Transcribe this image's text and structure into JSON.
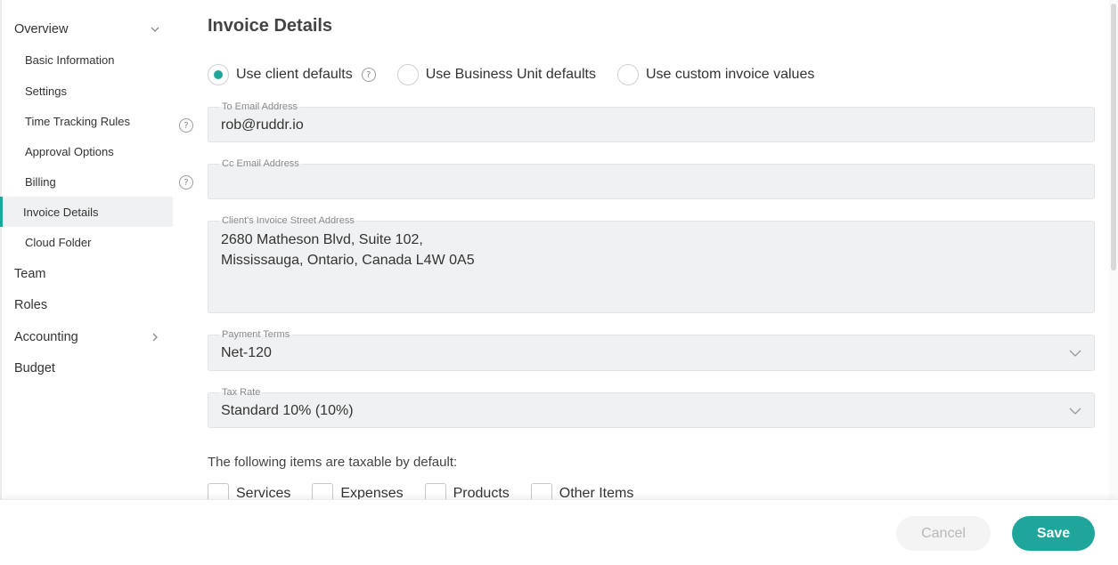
{
  "sidebar": {
    "overview": "Overview",
    "sub_items": [
      {
        "label": "Basic Information"
      },
      {
        "label": "Settings"
      },
      {
        "label": "Time Tracking Rules"
      },
      {
        "label": "Approval Options"
      },
      {
        "label": "Billing"
      },
      {
        "label": "Invoice Details"
      },
      {
        "label": "Cloud Folder"
      }
    ],
    "team": "Team",
    "roles": "Roles",
    "accounting": "Accounting",
    "budget": "Budget",
    "help_glyph": "?"
  },
  "main": {
    "title": "Invoice Details",
    "radios": [
      {
        "label": "Use client defaults",
        "selected": true
      },
      {
        "label": "Use Business Unit defaults",
        "selected": false
      },
      {
        "label": "Use custom invoice values",
        "selected": false
      }
    ],
    "fields": {
      "to_email": {
        "label": "To Email Address",
        "value": "rob@ruddr.io"
      },
      "cc_email": {
        "label": "Cc Email Address",
        "value": ""
      },
      "street": {
        "label": "Client's Invoice Street Address",
        "value": "2680 Matheson Blvd, Suite 102,\nMississauga, Ontario, Canada L4W 0A5"
      },
      "payment_terms": {
        "label": "Payment Terms",
        "value": "Net-120"
      },
      "tax_rate": {
        "label": "Tax Rate",
        "value": "Standard 10% (10%)"
      }
    },
    "taxable_label": "The following items are taxable by default:",
    "taxable_items": [
      "Services",
      "Expenses",
      "Products",
      "Other Items"
    ]
  },
  "footer": {
    "cancel": "Cancel",
    "save": "Save"
  },
  "colors": {
    "accent": "#1fa59a",
    "field_bg": "#f0f1f2"
  },
  "icons": {
    "chevron": "chevron-down-icon",
    "help": "help-circle-icon"
  }
}
